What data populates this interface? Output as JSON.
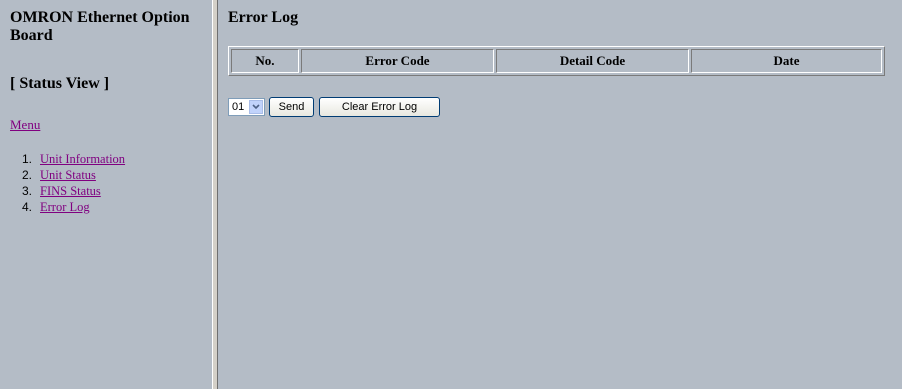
{
  "sidebar": {
    "brand": "OMRON Ethernet Option Board",
    "view_title": "[ Status View ]",
    "menu_label": "Menu",
    "items": [
      {
        "num": "1.",
        "label": "Unit Information"
      },
      {
        "num": "2.",
        "label": "Unit Status"
      },
      {
        "num": "3.",
        "label": "FINS Status"
      },
      {
        "num": "4.",
        "label": "Error Log"
      }
    ]
  },
  "main": {
    "title": "Error Log",
    "table": {
      "headers": [
        "No.",
        "Error Code",
        "Detail Code",
        "Date"
      ]
    },
    "controls": {
      "select_value": "01",
      "send_label": "Send",
      "clear_label": "Clear Error Log"
    }
  },
  "colors": {
    "background": "#b4bcc6",
    "link_visited": "#800080"
  }
}
